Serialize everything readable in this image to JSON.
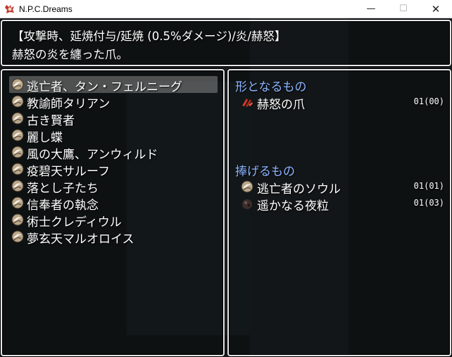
{
  "window": {
    "title": "N.P.C.Dreams",
    "min_label": "—",
    "max_label": "☐",
    "close_label": "✕"
  },
  "help": {
    "line1": "【攻撃時、延焼付与/延焼 (0.5%ダメージ)/炎/赫怒】",
    "line2": "赫怒の炎を纏った爪。"
  },
  "list": {
    "items": [
      {
        "label": "逃亡者、タン・フェルニーグ",
        "icon": "soul-icon"
      },
      {
        "label": "教諭師タリアン",
        "icon": "soul-icon"
      },
      {
        "label": "古き賢者",
        "icon": "soul-icon"
      },
      {
        "label": "麗し蝶",
        "icon": "soul-icon"
      },
      {
        "label": "風の大鷹、アンウィルド",
        "icon": "soul-icon"
      },
      {
        "label": "疫碧天サルーフ",
        "icon": "soul-icon"
      },
      {
        "label": "落とし子たち",
        "icon": "soul-icon"
      },
      {
        "label": "信奉者の執念",
        "icon": "soul-icon"
      },
      {
        "label": "術士クレディウル",
        "icon": "soul-icon"
      },
      {
        "label": "夢玄天マルオロイス",
        "icon": "soul-icon"
      }
    ],
    "selected_index": 0
  },
  "detail": {
    "form_header": "形となるもの",
    "form_items": [
      {
        "label": "赫怒の爪",
        "count": "01(00)",
        "icon": "claw-icon"
      }
    ],
    "offer_header": "捧げるもの",
    "offer_items": [
      {
        "label": "逃亡者のソウル",
        "count": "01(01)",
        "icon": "soul-icon"
      },
      {
        "label": "遥かなる夜粒",
        "count": "01(03)",
        "icon": "night-grain-icon"
      }
    ]
  },
  "colors": {
    "section_header": "#8cb4ff",
    "window_border": "#e8e8e8",
    "text": "#ffffff"
  }
}
